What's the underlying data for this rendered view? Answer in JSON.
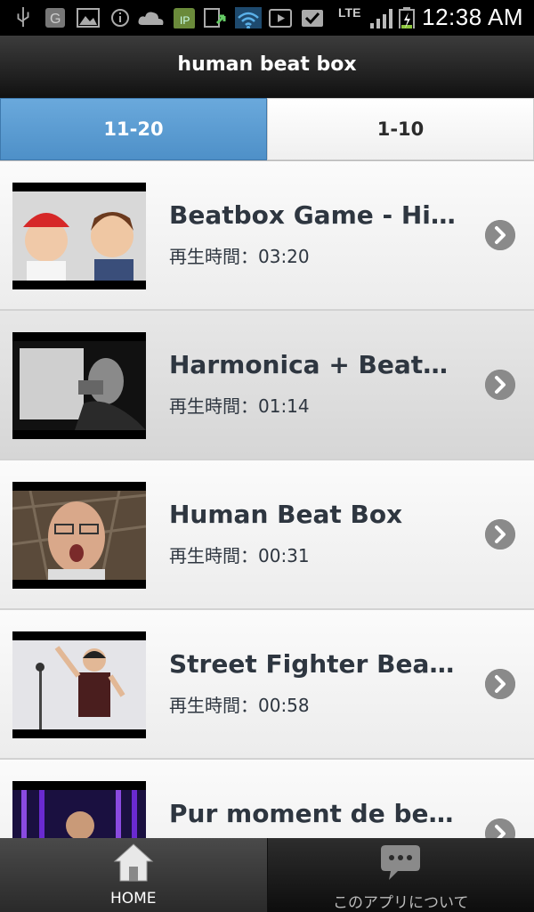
{
  "status_bar": {
    "time": "12:38 AM",
    "network": "LTE",
    "icons": [
      "usb-icon",
      "g-icon",
      "image-icon",
      "info-icon",
      "cloud-icon",
      "ip-icon",
      "download-icon",
      "wifi-icon",
      "play-store-icon",
      "check-icon",
      "lte-icon",
      "signal-icon",
      "battery-icon"
    ]
  },
  "header": {
    "title": "human beat box"
  },
  "tabs": [
    {
      "label": "11-20",
      "active": true
    },
    {
      "label": "1-10",
      "active": false
    }
  ],
  "videos": [
    {
      "title": "Beatbox Game - Hikaki...",
      "duration": "再生時間：03:20"
    },
    {
      "title": "Harmonica + Beatbox: ...",
      "duration": "再生時間：01:14"
    },
    {
      "title": "Human Beat Box",
      "duration": "再生時間：00:31"
    },
    {
      "title": "Street Fighter Beatbox",
      "duration": "再生時間：00:58"
    },
    {
      "title": "Pur moment de beat b...",
      "duration": ""
    }
  ],
  "bottom_nav": {
    "home": {
      "label": "HOME",
      "icon": "home-icon"
    },
    "about": {
      "label": "このアプリについて",
      "icon": "chat-bubble-icon"
    }
  },
  "colors": {
    "accent": "#5b9bd5",
    "header": "#1e1e1e",
    "text": "#2e3640"
  }
}
